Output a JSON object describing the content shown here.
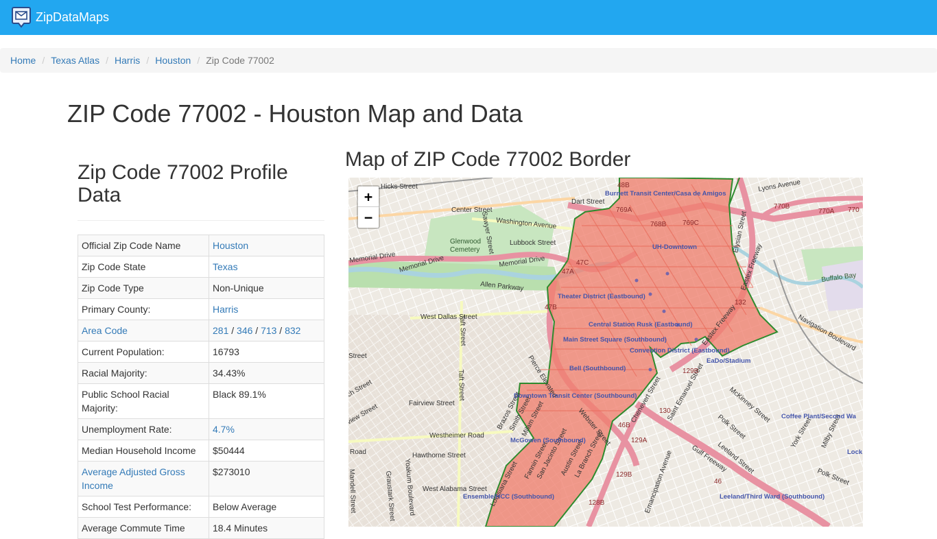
{
  "nav": {
    "brand": "ZipDataMaps"
  },
  "breadcrumb": {
    "items": [
      "Home",
      "Texas Atlas",
      "Harris",
      "Houston"
    ],
    "current": "Zip Code 77002"
  },
  "page_title": "ZIP Code 77002 - Houston Map and Data",
  "profile": {
    "title": "Zip Code 77002 Profile Data",
    "rows": [
      {
        "label": "Official Zip Code Name",
        "value": "Houston"
      },
      {
        "label": "Zip Code State",
        "value": "Texas"
      },
      {
        "label": "Zip Code Type",
        "value": "Non-Unique"
      },
      {
        "label": "Primary County:",
        "value": "Harris"
      },
      {
        "label": "Area Code",
        "value": "",
        "codes": [
          "281",
          "346",
          "713",
          "832"
        ]
      },
      {
        "label": "Current Population:",
        "value": "16793"
      },
      {
        "label": "Racial Majority:",
        "value": "34.43%"
      },
      {
        "label": "Public School Racial Majority:",
        "value": "Black 89.1%"
      },
      {
        "label": "Unemployment Rate:",
        "value": "4.7%"
      },
      {
        "label": "Median Household Income",
        "value": "$50444"
      },
      {
        "label": "Average Adjusted Gross Income",
        "value": "$273010"
      },
      {
        "label": "School Test Performance:",
        "value": "Below Average"
      },
      {
        "label": "Average Commute Time",
        "value": "18.4 Minutes"
      }
    ]
  },
  "map": {
    "title": "Map of ZIP Code 77002 Border",
    "zoom_in": "+",
    "zoom_out": "−",
    "colors": {
      "zip_fill": "#f08070",
      "zip_border": "#2e8b2e",
      "freeway": "#e892a2",
      "water": "#aad3df",
      "park": "#c8e6c0"
    },
    "streets": [
      "Hicks Street",
      "Center Street",
      "Dart Street",
      "Washington Avenue",
      "Lubbock Street",
      "Sawyer Street",
      "Memorial Drive",
      "Memorial Drive",
      "Memorial Drive",
      "Allen Parkway",
      "West Dallas Street",
      "Taft Street",
      "Taft Street",
      "Fairview Street",
      "Westheimer Road",
      "Hawthorne Street",
      "West Alabama Street",
      "Yoakum Boulevard",
      "Graustark Street",
      "Mandell Street",
      "Brazos Street",
      "Smith Street",
      "Milam Street",
      "Louisiana Street",
      "Fannin Street",
      "San Jacinto Street",
      "Austin Street",
      "La Branch Street",
      "Webster Street",
      "Pierce Elevated",
      "Chenevert Street",
      "Saint Emanuel Street",
      "Emancipation Avenue",
      "Gulf Freeway",
      "McKinney Street",
      "Polk Street",
      "Leeland Street",
      "Polk Street",
      "Navigation Boulevard",
      "Lyons Avenue",
      "Elysian Street",
      "Eastex Freeway",
      "Eastex Freeway",
      "York Street",
      "Milby Street",
      "Street",
      "ch Street",
      "view Street",
      "Road"
    ],
    "stations": [
      "Burnett Transit Center/Casa de Amigos",
      "UH-Downtown",
      "Theater District (Eastbound)",
      "Central Station Rusk (Eastbound)",
      "Main Street Square (Southbound)",
      "Convention District (Eastbound)",
      "EaDo/Stadium",
      "Bell (Southbound)",
      "Downtown Transit Center (Southbound)",
      "McGowen (Southbound)",
      "Ensemble/HCC (Southbound)",
      "Leeland/Third Ward (Southbound)",
      "Coffee Plant/Second Wa",
      "Lock"
    ],
    "exits": [
      "48B",
      "769A",
      "768B",
      "769C",
      "47C",
      "47A",
      "47B",
      "770B",
      "770A",
      "770",
      "132",
      "129B",
      "130",
      "46B",
      "129A",
      "129B",
      "46",
      "128B"
    ],
    "park_labels": [
      "Glenwood",
      "Cemetery"
    ],
    "water_labels": [
      "Buffalo Bay"
    ]
  }
}
